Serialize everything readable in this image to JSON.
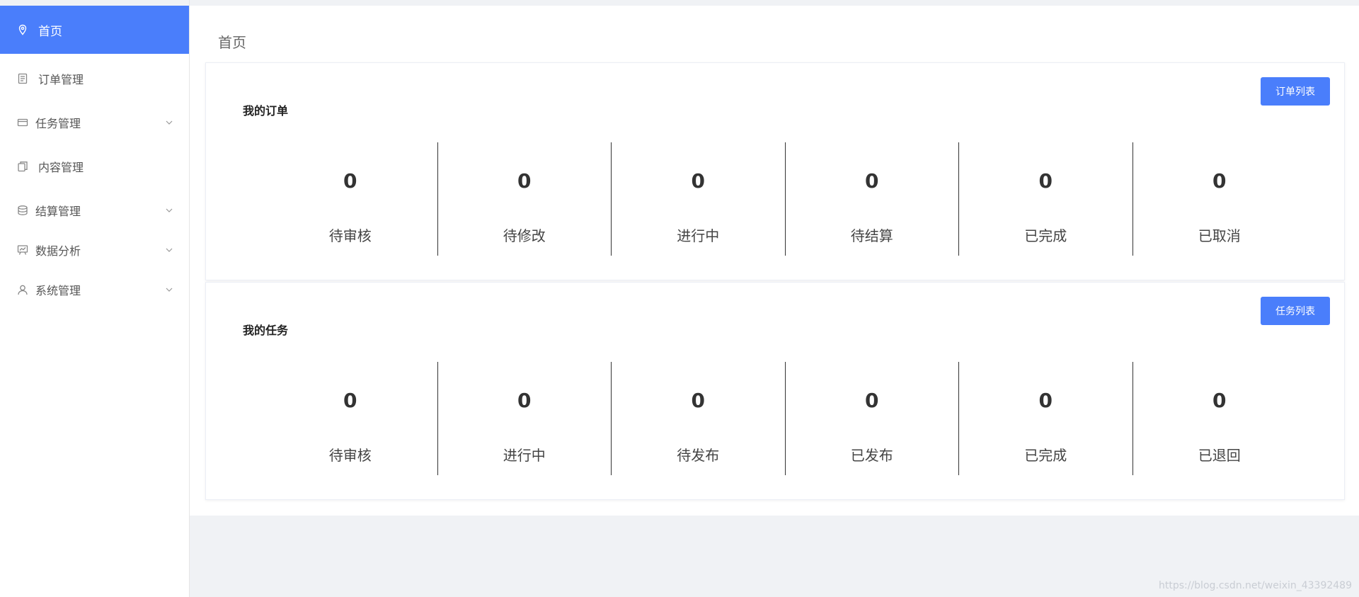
{
  "sidebar": {
    "items": [
      {
        "label": "首页",
        "icon": "location-pin-icon",
        "active": true,
        "has_submenu": false
      },
      {
        "label": "订单管理",
        "icon": "document-icon",
        "active": false,
        "has_submenu": false
      },
      {
        "label": "任务管理",
        "icon": "card-icon",
        "active": false,
        "has_submenu": true
      },
      {
        "label": "内容管理",
        "icon": "copy-icon",
        "active": false,
        "has_submenu": false
      },
      {
        "label": "结算管理",
        "icon": "coins-icon",
        "active": false,
        "has_submenu": true
      },
      {
        "label": "数据分析",
        "icon": "chart-board-icon",
        "active": false,
        "has_submenu": true
      },
      {
        "label": "系统管理",
        "icon": "user-icon",
        "active": false,
        "has_submenu": true
      }
    ]
  },
  "breadcrumb": "首页",
  "orders_panel": {
    "title": "我的订单",
    "button": "订单列表",
    "stats": [
      {
        "value": "0",
        "label": "待审核"
      },
      {
        "value": "0",
        "label": "待修改"
      },
      {
        "value": "0",
        "label": "进行中"
      },
      {
        "value": "0",
        "label": "待结算"
      },
      {
        "value": "0",
        "label": "已完成"
      },
      {
        "value": "0",
        "label": "已取消"
      }
    ]
  },
  "tasks_panel": {
    "title": "我的任务",
    "button": "任务列表",
    "stats": [
      {
        "value": "0",
        "label": "待审核"
      },
      {
        "value": "0",
        "label": "进行中"
      },
      {
        "value": "0",
        "label": "待发布"
      },
      {
        "value": "0",
        "label": "已发布"
      },
      {
        "value": "0",
        "label": "已完成"
      },
      {
        "value": "0",
        "label": "已退回"
      }
    ]
  },
  "watermark": "https://blog.csdn.net/weixin_43392489",
  "colors": {
    "accent": "#4a7efb",
    "background": "#f0f2f5",
    "sidebar_text": "#555555"
  }
}
